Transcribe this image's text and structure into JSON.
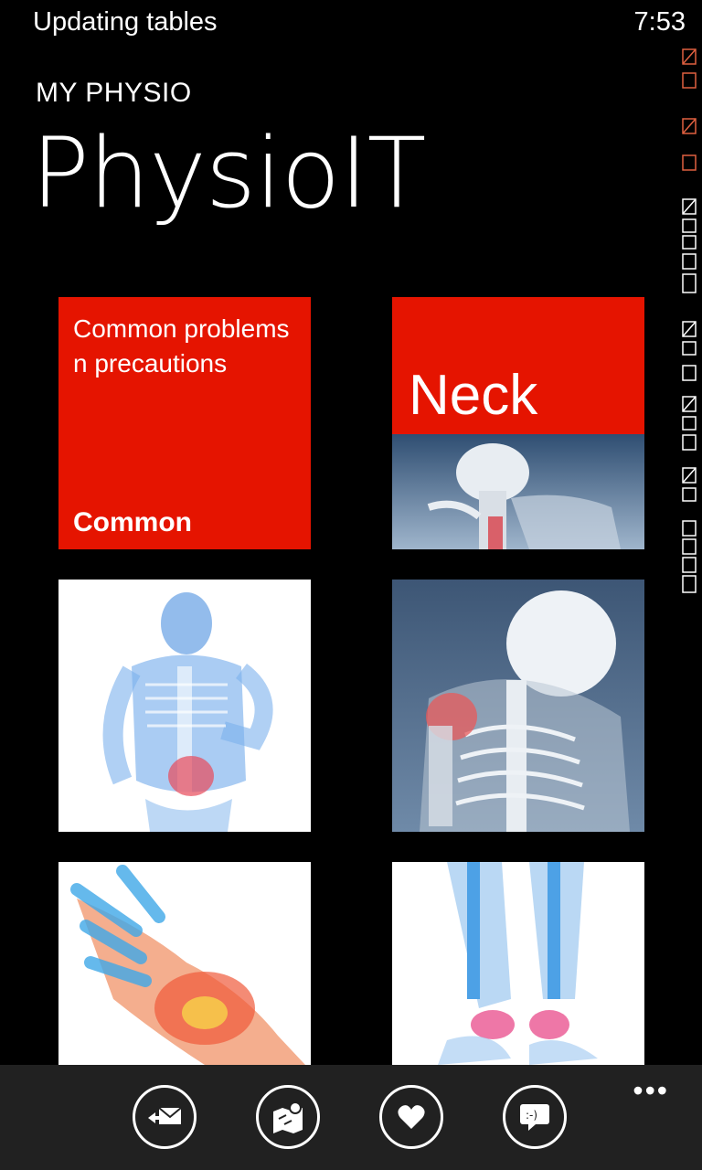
{
  "status": {
    "text": "Updating tables",
    "time": "7:53"
  },
  "app": {
    "subtitle": "MY PHYSIO",
    "title": "PhysioIT"
  },
  "tiles": [
    {
      "description": "Common problems n precautions",
      "name": "Common"
    },
    {
      "name": "Neck"
    }
  ],
  "appbar": {
    "more": "•••",
    "buttons": [
      "mail-reply-icon",
      "map-icon",
      "heart-icon",
      "chat-smiley-icon"
    ]
  },
  "colors": {
    "accent": "#e51400",
    "background": "#000000",
    "appbar": "#212121"
  }
}
